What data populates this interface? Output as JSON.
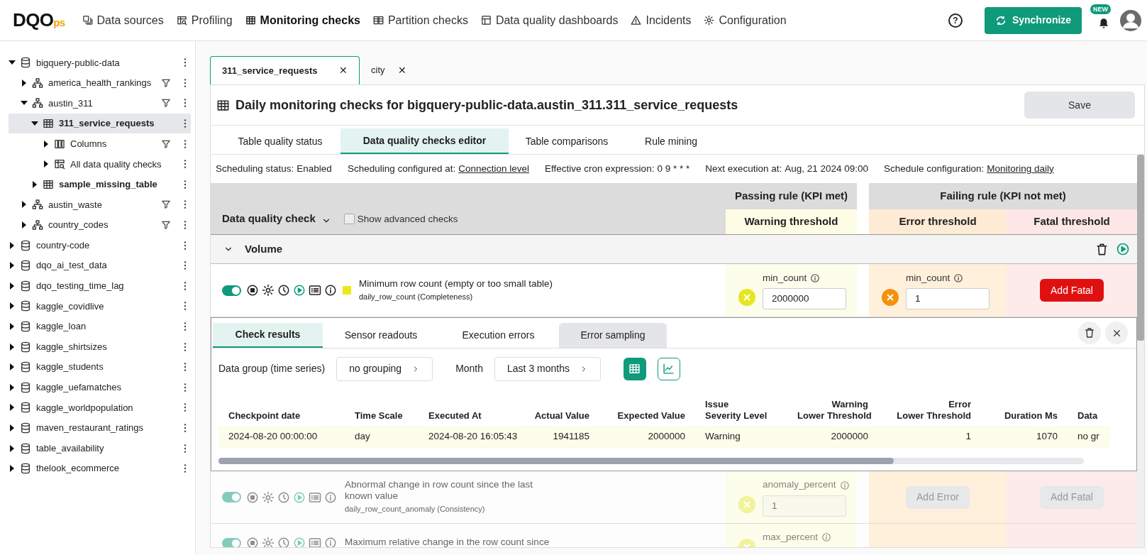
{
  "nav": {
    "logo": {
      "main": "DQO",
      "suffix": "ps"
    },
    "items": [
      {
        "label": "Data sources",
        "selected": false
      },
      {
        "label": "Profiling",
        "selected": false
      },
      {
        "label": "Monitoring checks",
        "selected": true
      },
      {
        "label": "Partition checks",
        "selected": false
      },
      {
        "label": "Data quality dashboards",
        "selected": false
      },
      {
        "label": "Incidents",
        "selected": false
      },
      {
        "label": "Configuration",
        "selected": false
      }
    ],
    "help": "?",
    "sync": "Synchronize",
    "badge": "NEW"
  },
  "tree": [
    {
      "label": "bigquery-public-data",
      "kind": "connection",
      "expanded": true,
      "selected": false,
      "filter": false,
      "children": [
        {
          "label": "america_health_rankings",
          "kind": "schema",
          "expanded": false,
          "selected": false,
          "filter": true
        },
        {
          "label": "austin_311",
          "kind": "schema",
          "expanded": true,
          "selected": false,
          "filter": true,
          "children": [
            {
              "label": "311_service_requests",
              "kind": "table",
              "expanded": true,
              "selected": true,
              "filter": false,
              "children": [
                {
                  "label": "Columns",
                  "kind": "columns",
                  "expanded": false,
                  "selected": false,
                  "filter": true
                },
                {
                  "label": "All data quality checks",
                  "kind": "checks",
                  "expanded": false,
                  "selected": false,
                  "filter": false
                }
              ]
            },
            {
              "label": "sample_missing_table",
              "kind": "table",
              "expanded": false,
              "selected": false,
              "filter": false
            }
          ]
        },
        {
          "label": "austin_waste",
          "kind": "schema",
          "expanded": false,
          "selected": false,
          "filter": true
        },
        {
          "label": "country_codes",
          "kind": "schema",
          "expanded": false,
          "selected": false,
          "filter": true
        }
      ]
    },
    {
      "label": "country-code",
      "kind": "connection",
      "expanded": false,
      "selected": false,
      "filter": false
    },
    {
      "label": "dqo_ai_test_data",
      "kind": "connection",
      "expanded": false,
      "selected": false,
      "filter": false
    },
    {
      "label": "dqo_testing_time_lag",
      "kind": "connection",
      "expanded": false,
      "selected": false,
      "filter": false
    },
    {
      "label": "kaggle_covidlive",
      "kind": "connection",
      "expanded": false,
      "selected": false,
      "filter": false
    },
    {
      "label": "kaggle_loan",
      "kind": "connection",
      "expanded": false,
      "selected": false,
      "filter": false
    },
    {
      "label": "kaggle_shirtsizes",
      "kind": "connection",
      "expanded": false,
      "selected": false,
      "filter": false
    },
    {
      "label": "kaggle_students",
      "kind": "connection",
      "expanded": false,
      "selected": false,
      "filter": false
    },
    {
      "label": "kaggle_uefamatches",
      "kind": "connection",
      "expanded": false,
      "selected": false,
      "filter": false
    },
    {
      "label": "kaggle_worldpopulation",
      "kind": "connection",
      "expanded": false,
      "selected": false,
      "filter": false
    },
    {
      "label": "maven_restaurant_ratings",
      "kind": "connection",
      "expanded": false,
      "selected": false,
      "filter": false
    },
    {
      "label": "table_availability",
      "kind": "connection",
      "expanded": false,
      "selected": false,
      "filter": false
    },
    {
      "label": "thelook_ecommerce",
      "kind": "connection",
      "expanded": false,
      "selected": false,
      "filter": false
    }
  ],
  "tabs": [
    {
      "label": "311_service_requests",
      "selected": true,
      "close": "✕"
    },
    {
      "label": "city",
      "selected": false,
      "close": "✕"
    }
  ],
  "title": "Daily monitoring checks for bigquery-public-data.austin_311.311_service_requests",
  "save": "Save",
  "subtabs": [
    {
      "label": "Table quality status",
      "selected": false
    },
    {
      "label": "Data quality checks editor",
      "selected": true
    },
    {
      "label": "Table comparisons",
      "selected": false
    },
    {
      "label": "Rule mining",
      "selected": false
    }
  ],
  "schedule": [
    {
      "label": "Scheduling status:",
      "value": "Enabled",
      "link": false
    },
    {
      "label": "Scheduling configured at:",
      "value": "Connection level",
      "link": true
    },
    {
      "label": "Effective cron expression:",
      "value": "0 9 * * *",
      "link": false
    },
    {
      "label": "Next execution at:",
      "value": "Aug, 21 2024 09:00",
      "link": false
    },
    {
      "label": "Schedule configuration:",
      "value": "Monitoring daily",
      "link": true
    }
  ],
  "header": {
    "check_column": "Data quality check",
    "advanced": {
      "label": "Show advanced checks",
      "checked": false
    },
    "passing": "Passing rule (KPI met)",
    "failing": "Failing rule (KPI not met)",
    "warning": "Warning threshold",
    "error": "Error threshold",
    "fatal": "Fatal threshold"
  },
  "group": {
    "label": "Volume",
    "expanded": true
  },
  "checks": [
    {
      "name": "Minimum row count (empty or too small table)",
      "sub": "daily_row_count (Completeness)",
      "enabled": true,
      "configured": true,
      "color": "#eaea1a",
      "warning": {
        "kind": "field",
        "param": "min_count",
        "value": "2000000"
      },
      "error": {
        "kind": "field",
        "param": "min_count",
        "value": "1"
      },
      "fatal": {
        "kind": "button",
        "label": "Add Fatal"
      }
    },
    {
      "name": "Abnormal change in row count since the last known value",
      "sub": "daily_row_count_anomaly (Consistency)",
      "enabled": true,
      "configured": false,
      "warning": {
        "kind": "field",
        "param": "anomaly_percent",
        "value": "1"
      },
      "error": {
        "kind": "button",
        "label": "Add Error"
      },
      "fatal": {
        "kind": "button",
        "label": "Add Fatal"
      }
    },
    {
      "name": "Maximum relative change in the row count since",
      "enabled": true,
      "configured": false,
      "warning": {
        "kind": "field",
        "param": "max_percent"
      }
    }
  ],
  "results": {
    "tabs": [
      {
        "label": "Check results",
        "selected": true,
        "highlighted": false
      },
      {
        "label": "Sensor readouts",
        "selected": false,
        "highlighted": false
      },
      {
        "label": "Execution errors",
        "selected": false,
        "highlighted": false
      },
      {
        "label": "Error sampling",
        "selected": false,
        "highlighted": true
      }
    ],
    "filters": [
      {
        "label": "Data group (time series)",
        "value": "no grouping"
      },
      {
        "label": "Month",
        "value": "Last 3 months"
      }
    ],
    "views": [
      {
        "kind": "table",
        "selected": true
      },
      {
        "kind": "chart",
        "selected": false
      }
    ],
    "columns": [
      {
        "lines": [
          "Checkpoint date"
        ]
      },
      {
        "lines": [
          "Time Scale"
        ]
      },
      {
        "lines": [
          "Executed At"
        ]
      },
      {
        "lines": [
          "Actual Value"
        ]
      },
      {
        "lines": [
          "Expected Value"
        ]
      },
      {
        "lines": [
          "Issue",
          "Severity Level"
        ]
      },
      {
        "lines": [
          "Warning",
          "Lower Threshold"
        ]
      },
      {
        "lines": [
          "Error",
          "Lower Threshold"
        ]
      },
      {
        "lines": [
          "Duration Ms"
        ]
      },
      {
        "lines": [
          "Data"
        ]
      }
    ],
    "rows": [
      {
        "kind": "warning",
        "cells": [
          "2024-08-20 00:00:00",
          "day",
          "2024-08-20 16:05:43",
          "1941185",
          "2000000",
          "Warning",
          "2000000",
          "1",
          "1070",
          "no gr"
        ]
      }
    ]
  }
}
